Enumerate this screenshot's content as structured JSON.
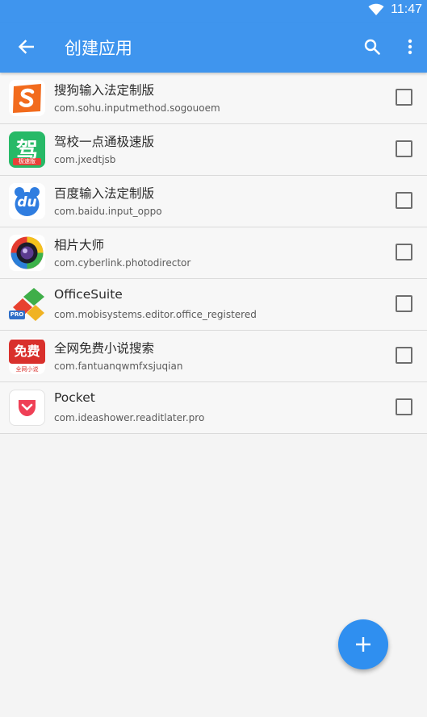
{
  "status_bar": {
    "time": "11:47"
  },
  "app_bar": {
    "title": "创建应用"
  },
  "apps": [
    {
      "name": "搜狗输入法定制版",
      "package": "com.sohu.inputmethod.sogouoem",
      "icon": "sogou-icon",
      "checked": false
    },
    {
      "name": "驾校一点通极速版",
      "package": "com.jxedtjsb",
      "icon": "jiaxiao-icon",
      "checked": false,
      "icon_text": "驾",
      "icon_subtext": "极速版"
    },
    {
      "name": "百度输入法定制版",
      "package": "com.baidu.input_oppo",
      "icon": "baidu-input-icon",
      "checked": false,
      "icon_text": "du"
    },
    {
      "name": "相片大师",
      "package": "com.cyberlink.photodirector",
      "icon": "photodirector-icon",
      "checked": false
    },
    {
      "name": "OfficeSuite",
      "package": "com.mobisystems.editor.office_registered",
      "icon": "officesuite-icon",
      "checked": false,
      "icon_text": "PRO"
    },
    {
      "name": "全网免费小说搜索",
      "package": "com.fantuanqwmfxsjuqian",
      "icon": "free-novel-icon",
      "checked": false,
      "icon_text": "免费",
      "icon_subtext": "全网小说"
    },
    {
      "name": "Pocket",
      "package": "com.ideashower.readitlater.pro",
      "icon": "pocket-icon",
      "checked": false
    }
  ],
  "colors": {
    "primary": "#3f95ee",
    "fab": "#2f8ff0"
  }
}
